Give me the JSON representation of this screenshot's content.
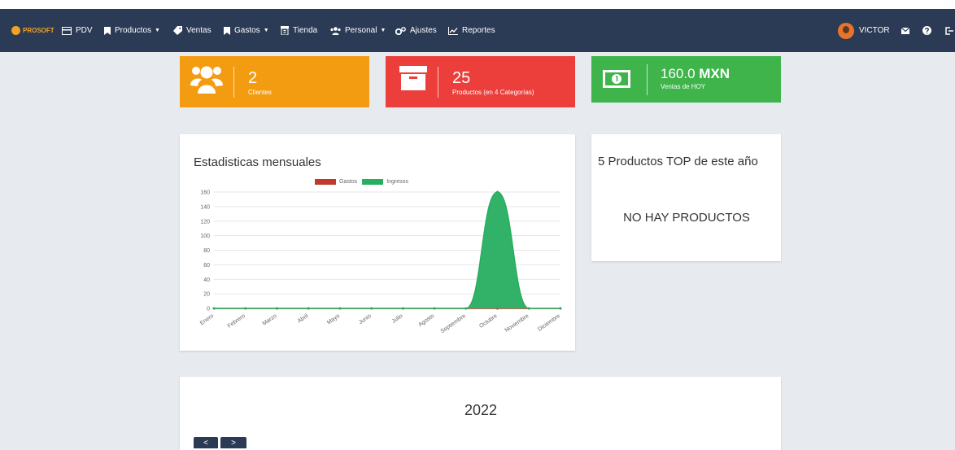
{
  "navbar": {
    "brand": "PROSOFT",
    "items": [
      {
        "label": "PDV",
        "icon": "pos-icon"
      },
      {
        "label": "Productos",
        "icon": "bookmark-icon"
      },
      {
        "label": "Ventas",
        "icon": "tag-icon"
      },
      {
        "label": "Gastos",
        "icon": "bookmark-icon"
      },
      {
        "label": "Tienda",
        "icon": "store-icon"
      },
      {
        "label": "Personal",
        "icon": "users-icon"
      },
      {
        "label": "Ajustes",
        "icon": "gears-icon"
      },
      {
        "label": "Reportes",
        "icon": "line-chart-icon"
      }
    ],
    "user": "VICTOR"
  },
  "stats": [
    {
      "value": "2",
      "label": "Clientes",
      "color": "#f39c12",
      "icon": "users-icon"
    },
    {
      "value": "25",
      "label": "Productos (en 4 Categorías)",
      "color": "#ec3e3b",
      "icon": "archive-icon"
    },
    {
      "value": "160.0",
      "value_unit": "MXN",
      "label": "Ventas de HOY",
      "color": "#3fb44a",
      "icon": "money-icon"
    }
  ],
  "monthly_panel": {
    "title": "Estadisticas mensuales"
  },
  "top_panel": {
    "title": "5 Productos TOP de este año",
    "empty_message": "NO HAY PRODUCTOS"
  },
  "calendar_panel": {
    "year": "2022",
    "prev": "<",
    "next": ">"
  },
  "chart_data": {
    "type": "area",
    "categories": [
      "Enero",
      "Febrero",
      "Marzo",
      "Abril",
      "Mayo",
      "Junio",
      "Julio",
      "Agosto",
      "Septiembre",
      "Octubre",
      "Noviembre",
      "Diciembre"
    ],
    "series": [
      {
        "name": "Gastos",
        "color": "#c0392b",
        "values": [
          0,
          0,
          0,
          0,
          0,
          0,
          0,
          0,
          0,
          0,
          0,
          0
        ]
      },
      {
        "name": "Ingresos",
        "color": "#27ae60",
        "values": [
          0,
          0,
          0,
          0,
          0,
          0,
          0,
          0,
          0,
          160,
          0,
          0
        ]
      }
    ],
    "yticks": [
      "0",
      "20",
      "40",
      "60",
      "80",
      "100",
      "120",
      "140",
      "160"
    ],
    "ylim": [
      0,
      160
    ],
    "grid": true,
    "legend": "top"
  }
}
